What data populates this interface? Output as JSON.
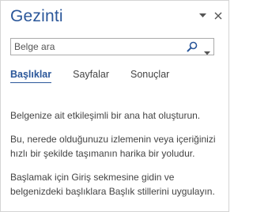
{
  "pane": {
    "title": "Gezinti",
    "options_icon": "chevron-down-icon",
    "close_icon": "close-icon"
  },
  "search": {
    "placeholder": "Belge ara",
    "value": "",
    "icon": "search-icon",
    "dropdown_icon": "chevron-down-icon"
  },
  "tabs": [
    {
      "label": "Başlıklar",
      "active": true
    },
    {
      "label": "Sayfalar",
      "active": false
    },
    {
      "label": "Sonuçlar",
      "active": false
    }
  ],
  "content": {
    "paragraph1": "Belgenize ait etkileşimli bir ana hat oluşturun.",
    "paragraph2": "Bu, nerede olduğunuzu izlemenin veya içeriğinizi hızlı bir şekilde taşımanın harika bir yoludur.",
    "paragraph3": "Başlamak için Giriş sekmesine gidin ve belgenizdeki başlıklara Başlık stillerini uygulayın."
  },
  "colors": {
    "accent": "#2b579a",
    "text": "#444444",
    "border": "#ababab"
  }
}
